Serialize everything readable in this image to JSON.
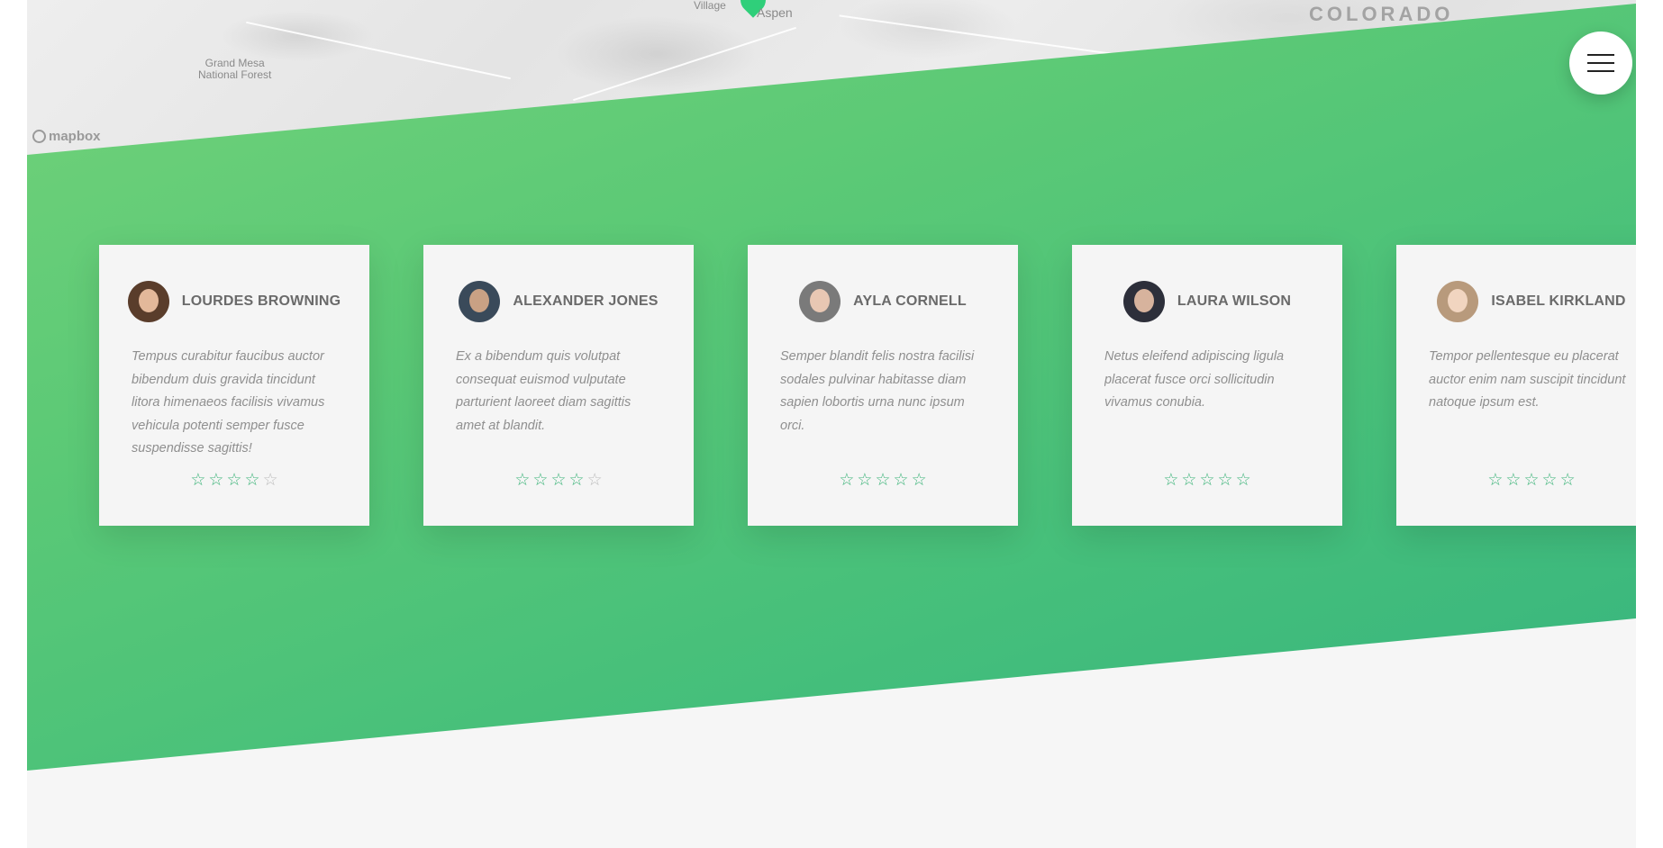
{
  "map": {
    "labels": [
      {
        "id": "village",
        "text": "Village"
      },
      {
        "id": "aspen",
        "text": "Aspen"
      },
      {
        "id": "grand-mesa",
        "text": "Grand Mesa\nNational Forest"
      }
    ],
    "state_label": "COLORADO",
    "attribution": "mapbox",
    "pin_color": "#2fcf7a"
  },
  "menu": {
    "icon": "hamburger-icon"
  },
  "accent_color": "#3fb57b",
  "testimonials": [
    {
      "name": "LOURDES BROWNING",
      "quote": "Tempus curabitur faucibus auctor bibendum duis gravida tincidunt litora himenaeos facilisis vivamus vehicula potenti semper fusce suspendisse sagittis!",
      "rating": 4,
      "max_rating": 5,
      "avatar_colors": [
        "#5a3d2b",
        "#e3b89a"
      ]
    },
    {
      "name": "ALEXANDER JONES",
      "quote": "Ex a bibendum quis volutpat consequat euismod vulputate parturient laoreet diam sagittis amet at blandit.",
      "rating": 4,
      "max_rating": 5,
      "avatar_colors": [
        "#3a4a5a",
        "#c9a184"
      ]
    },
    {
      "name": "AYLA CORNELL",
      "quote": "Semper blandit felis nostra facilisi sodales pulvinar habitasse diam sapien lobortis urna nunc ipsum orci.",
      "rating": 5,
      "max_rating": 5,
      "avatar_colors": [
        "#7a7a7a",
        "#e8c7b3"
      ]
    },
    {
      "name": "LAURA WILSON",
      "quote": "Netus eleifend adipiscing ligula placerat fusce orci sollicitudin vivamus conubia.",
      "rating": 5,
      "max_rating": 5,
      "avatar_colors": [
        "#2d2f3a",
        "#d7b39d"
      ]
    },
    {
      "name": "ISABEL KIRKLAND",
      "quote": "Tempor pellentesque eu placerat auctor enim nam suscipit tincidunt natoque ipsum est.",
      "rating": 5,
      "max_rating": 5,
      "avatar_colors": [
        "#b89a7c",
        "#f1d5c0"
      ]
    }
  ]
}
